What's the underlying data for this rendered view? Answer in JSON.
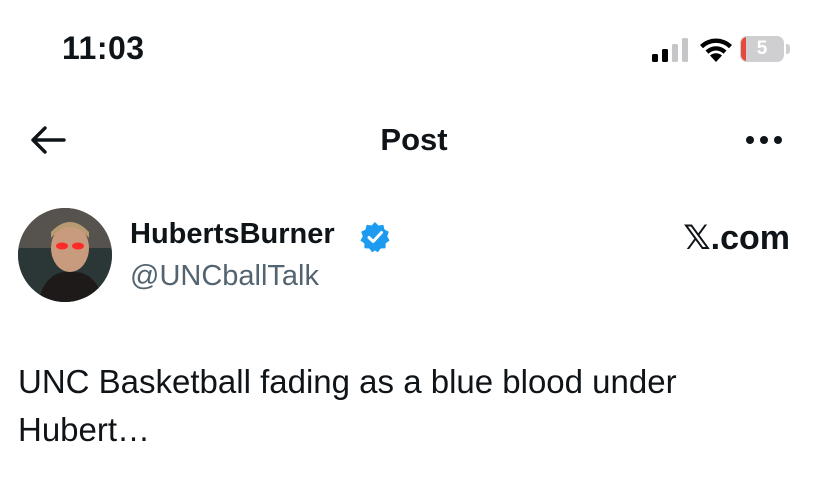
{
  "status_bar": {
    "time": "11:03",
    "battery_level_text": "5",
    "battery_level_percent": 5,
    "signal_bars_active": 2,
    "signal_bars_total": 4,
    "battery_low_color": "#e8473b"
  },
  "nav": {
    "title": "Post",
    "back_icon": "arrow-left-icon",
    "more_icon": "more-horizontal-icon"
  },
  "post": {
    "author_name": "HubertsBurner",
    "author_handle": "@UNCballTalk",
    "verified": true,
    "verified_color": "#1d9bf0",
    "watermark": "𝕏.com",
    "text": "UNC Basketball fading as a blue blood under Hubert…"
  }
}
